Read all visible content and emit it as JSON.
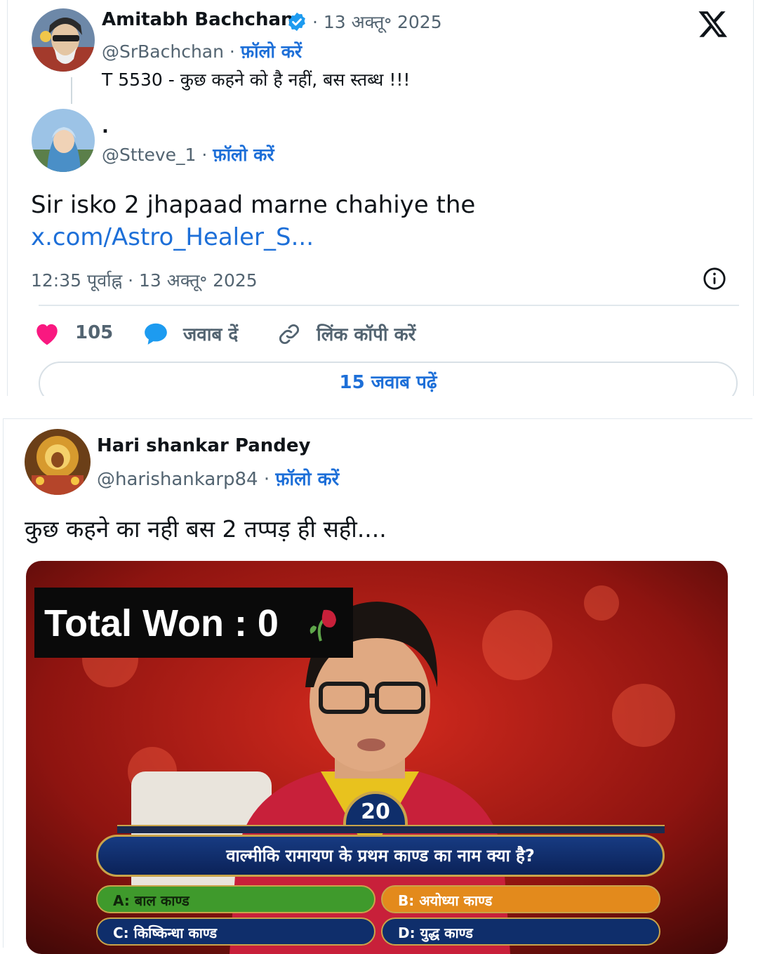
{
  "card1": {
    "main_tweet": {
      "author_name": "Amitabh Bachchan",
      "date": "· 13 अक्तू॰ 2025",
      "handle": "@SrBachchan",
      "separator": "·",
      "follow_label": "फ़ॉलो करें",
      "text": "T 5530 - कुछ कहने को है नहीं, बस  स्तब्ध  !!!"
    },
    "reply": {
      "author_name": ".",
      "handle": "@Stteve_1",
      "separator": "·",
      "follow_label": "फ़ॉलो करें",
      "text": "Sir isko 2 jhapaad marne chahiye the",
      "link": "x.com/Astro_Healer_S...",
      "timestamp": "12:35 पूर्वाह्न · 13 अक्तू॰ 2025"
    },
    "actions": {
      "like_count": "105",
      "reply_label": "जवाब दें",
      "copy_link_label": "लिंक कॉपी करें"
    },
    "read_replies_label": "15 जवाब पढ़ें",
    "icons": {
      "logo": "x-logo-icon",
      "verified": "verified-badge-icon",
      "info": "info-icon",
      "like": "heart-icon",
      "reply": "reply-bubble-icon",
      "link": "link-icon"
    },
    "colors": {
      "like": "#f91880",
      "link": "#1d9bf0",
      "verified": "#1d9bf0",
      "text": "#0f1419",
      "muted": "#536471"
    }
  },
  "card2": {
    "author_name": "Hari shankar Pandey",
    "handle": "@harishankarp84",
    "separator": "·",
    "follow_label": "फ़ॉलो करें",
    "text": "कुछ कहने का नही बस 2 तप्पड़ ही सही....",
    "media": {
      "overlay_text": "Total Won : 0",
      "timer_value": "20",
      "question": "वाल्मीकि रामायण के प्रथम काण्ड का नाम क्या है?",
      "options": [
        {
          "label": "A: बाल काण्ड",
          "state": "correct",
          "color": "#3f9a2c"
        },
        {
          "label": "B: अयोध्या काण्ड",
          "state": "selected-wrong",
          "color": "#e38a1c"
        },
        {
          "label": "C: किष्किन्धा काण्ड",
          "state": "default",
          "color": "#0f2e6b"
        },
        {
          "label": "D: युद्ध काण्ड",
          "state": "default",
          "color": "#0f2e6b"
        }
      ]
    }
  }
}
